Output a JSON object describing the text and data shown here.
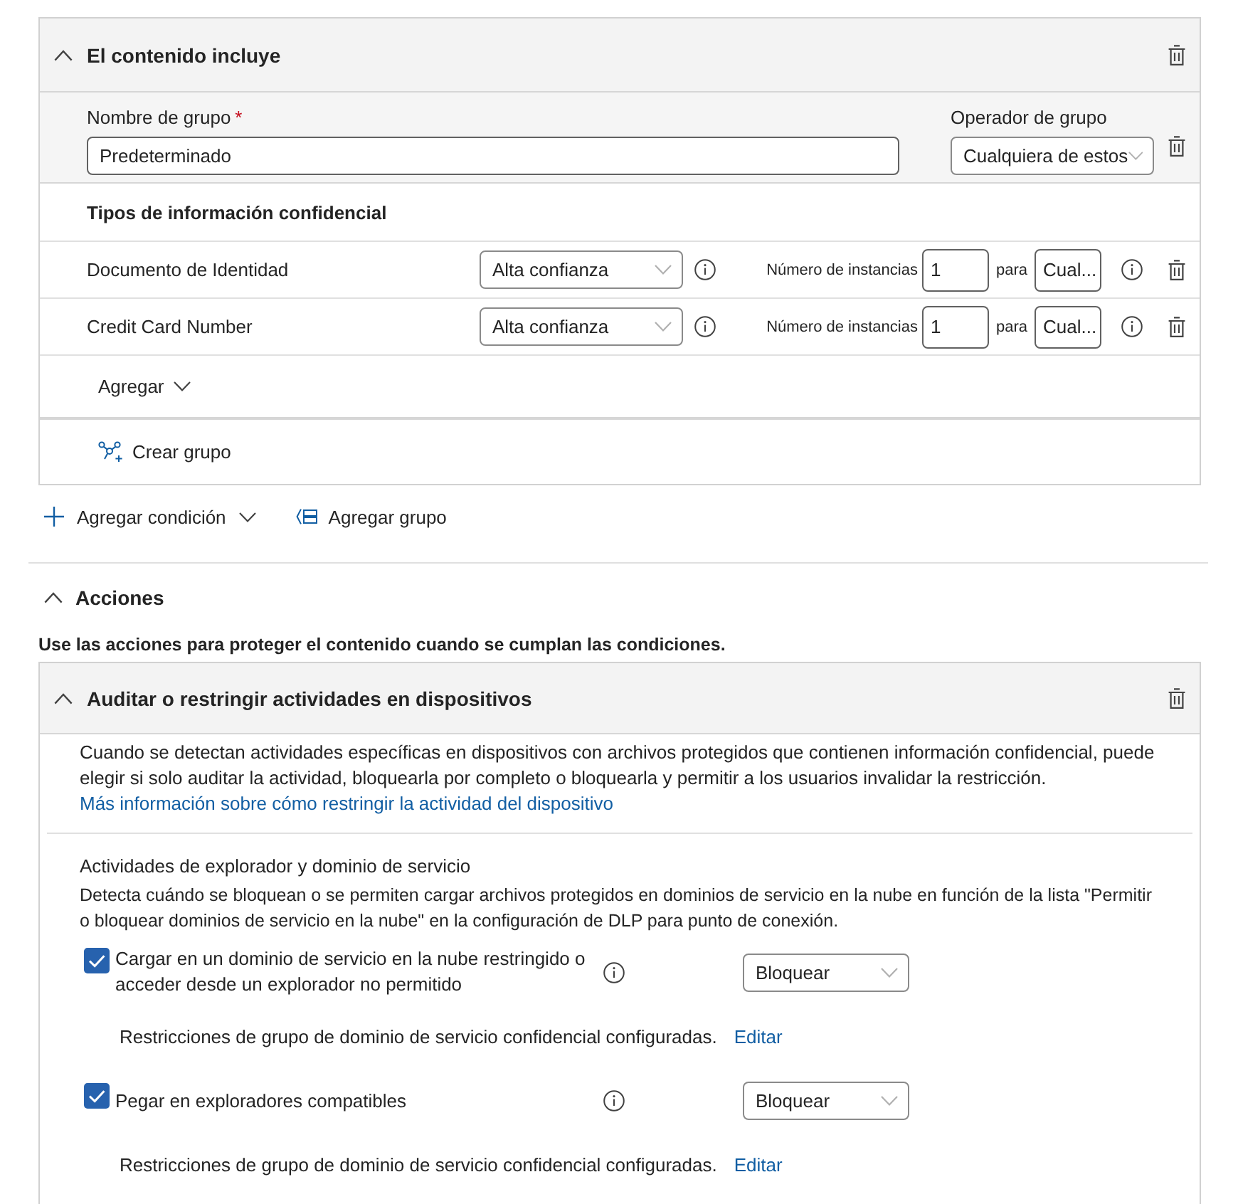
{
  "conditions_card": {
    "title": "El contenido incluye",
    "expanded": true,
    "group_name": {
      "label": "Nombre de grupo",
      "required_mark": "*",
      "value": "Predeterminado"
    },
    "group_operator": {
      "label": "Operador de grupo",
      "value": "Cualquiera de estos"
    },
    "types_heading": "Tipos de información confidencial",
    "types": [
      {
        "name": "Documento de Identidad",
        "confidence": "Alta confianza",
        "instances_label": "Número de instancias",
        "instances": "1",
        "for_label": "para",
        "for_value": "Cual..."
      },
      {
        "name": "Credit Card Number",
        "confidence": "Alta confianza",
        "instances_label": "Número de instancias",
        "instances": "1",
        "for_label": "para",
        "for_value": "Cual..."
      }
    ],
    "add_button": "Agregar",
    "create_group": "Crear grupo"
  },
  "condition_toolbar": {
    "add_condition": "Agregar condición",
    "add_group": "Agregar grupo"
  },
  "actions_section": {
    "title": "Acciones",
    "expanded": true,
    "description": "Use las acciones para proteger el contenido cuando se cumplan las condiciones."
  },
  "device_card": {
    "title": "Auditar o restringir actividades en dispositivos",
    "expanded": true,
    "description": "Cuando se detectan actividades específicas en dispositivos con archivos protegidos que contienen información confidencial, puede elegir si solo auditar la actividad, bloquearla por completo o bloquearla y permitir a los usuarios invalidar la restricción.",
    "link": "Más información sobre cómo restringir la actividad del dispositivo",
    "browser_domain": {
      "title": "Actividades de explorador y dominio de servicio",
      "description": "Detecta cuándo se bloquean o se permiten cargar archivos protegidos en dominios de servicio en la nube en función de la lista \"Permitir o bloquear dominios de servicio en la nube\" en la configuración de DLP para punto de conexión.",
      "activities": [
        {
          "label": "Cargar en un dominio de servicio en la nube restringido o acceder desde un explorador no permitido",
          "checked": true,
          "action": "Bloquear",
          "note": "Restricciones de grupo de dominio de servicio confidencial configuradas.",
          "edit_link": "Editar"
        },
        {
          "label": "Pegar en exploradores compatibles",
          "checked": true,
          "action": "Bloquear",
          "note": "Restricciones de grupo de dominio de servicio confidencial configuradas.",
          "edit_link": "Editar"
        }
      ]
    }
  }
}
